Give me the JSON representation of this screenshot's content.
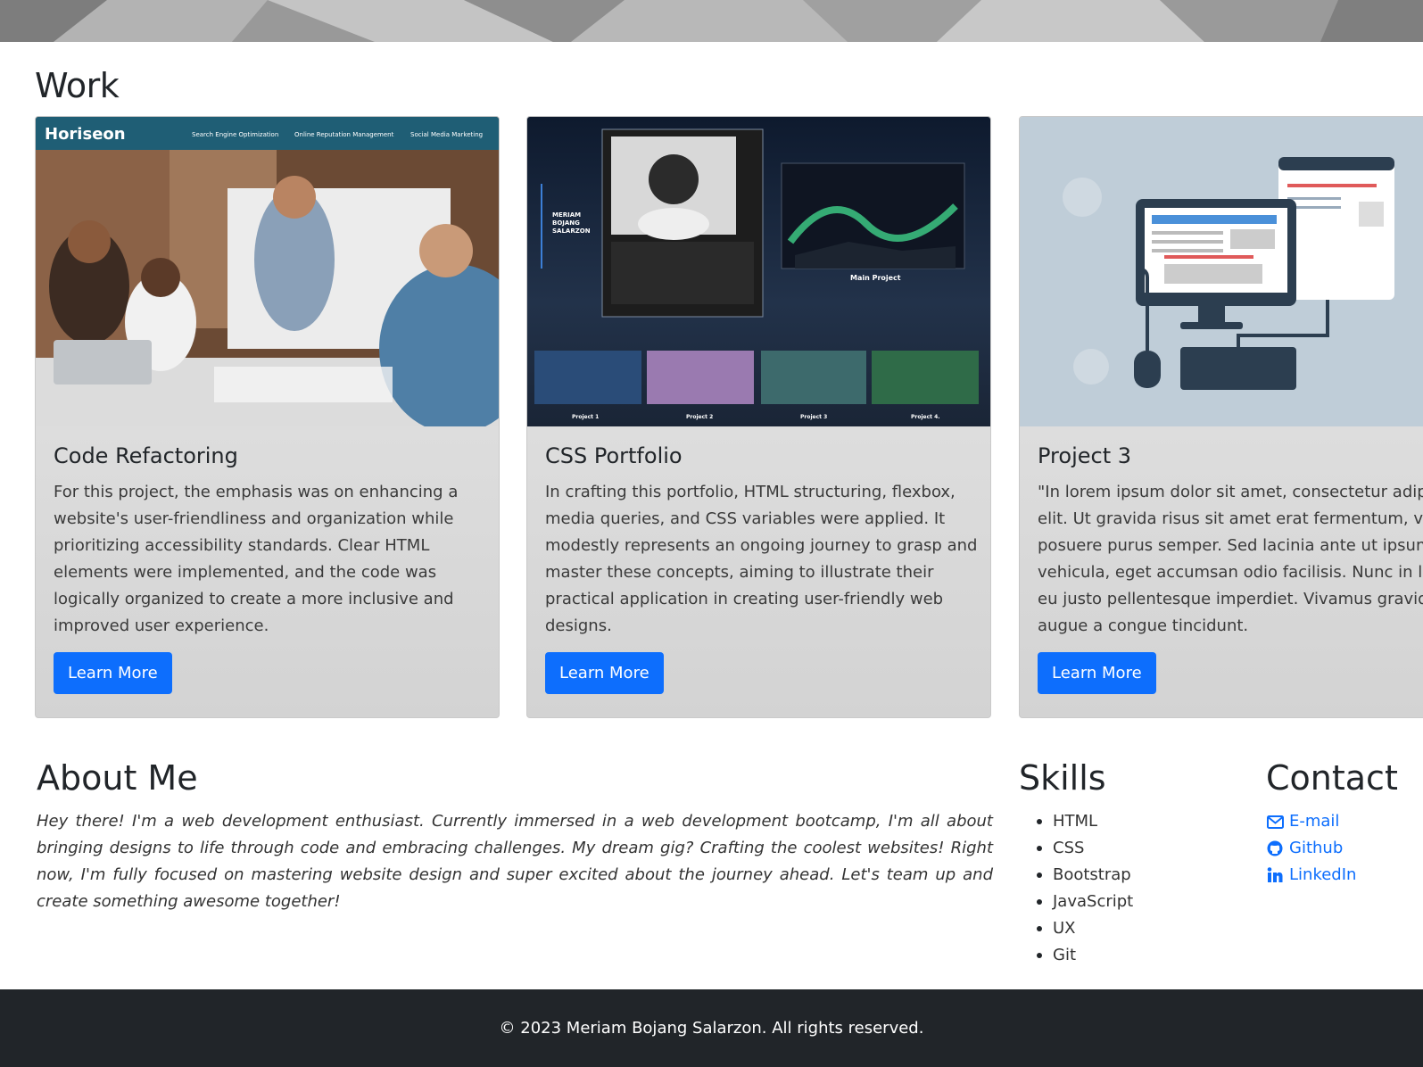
{
  "work": {
    "title": "Work",
    "cards": [
      {
        "title": "Code Refactoring",
        "text": "For this project, the emphasis was on enhancing a website's user-friendliness and organization while prioritizing accessibility standards. Clear HTML elements were implemented, and the code was logically organized to create a more inclusive and improved user experience.",
        "button": "Learn More",
        "image_nav": {
          "brand": "Horiseon",
          "links": [
            "Search Engine Optimization",
            "Online Reputation Management",
            "Social Media Marketing"
          ]
        }
      },
      {
        "title": "CSS Portfolio",
        "text": "In crafting this portfolio, HTML structuring, flexbox, media queries, and CSS variables were applied. It modestly represents an ongoing journey to grasp and master these concepts, aiming to illustrate their practical application in creating user-friendly web designs.",
        "button": "Learn More",
        "image_labels": {
          "name_lines": [
            "MERIAM",
            "BOJANG",
            "SALARZON"
          ],
          "main": "Main Project",
          "projects": [
            "Project 1",
            "Project 2",
            "Project 3",
            "Project 4."
          ]
        }
      },
      {
        "title": "Project 3",
        "text_lines": [
          "\"In lorem ipsum dolor sit amet, consectetur adipis",
          "elit. Ut gravida risus sit amet erat fermentum, vita",
          "posuere purus semper. Sed lacinia ante ut ipsum",
          "vehicula, eget accumsan odio facilisis. Nunc in lig",
          "eu justo pellentesque imperdiet. Vivamus gravida",
          "augue a congue tincidunt."
        ],
        "button": "Learn More"
      }
    ]
  },
  "about": {
    "title": "About Me",
    "text": "Hey there! I'm a web development enthusiast. Currently immersed in a web development bootcamp, I'm all about bringing designs to life through code and embracing challenges. My dream gig? Crafting the coolest websites! Right now, I'm fully focused on mastering website design and super excited about the journey ahead. Let's team up and create something awesome together!"
  },
  "skills": {
    "title": "Skills",
    "items": [
      "HTML",
      "CSS",
      "Bootstrap",
      "JavaScript",
      "UX",
      "Git"
    ]
  },
  "contact": {
    "title": "Contact",
    "links": [
      {
        "label": "E-mail",
        "icon": "envelope-icon"
      },
      {
        "label": "Github",
        "icon": "github-icon"
      },
      {
        "label": "LinkedIn",
        "icon": "linkedin-icon"
      }
    ]
  },
  "footer": {
    "text": "© 2023 Meriam Bojang Salarzon. All rights reserved."
  },
  "colors": {
    "primary": "#0d6efd",
    "footer_bg": "#212529",
    "card_bg": "#e0e0e0"
  }
}
